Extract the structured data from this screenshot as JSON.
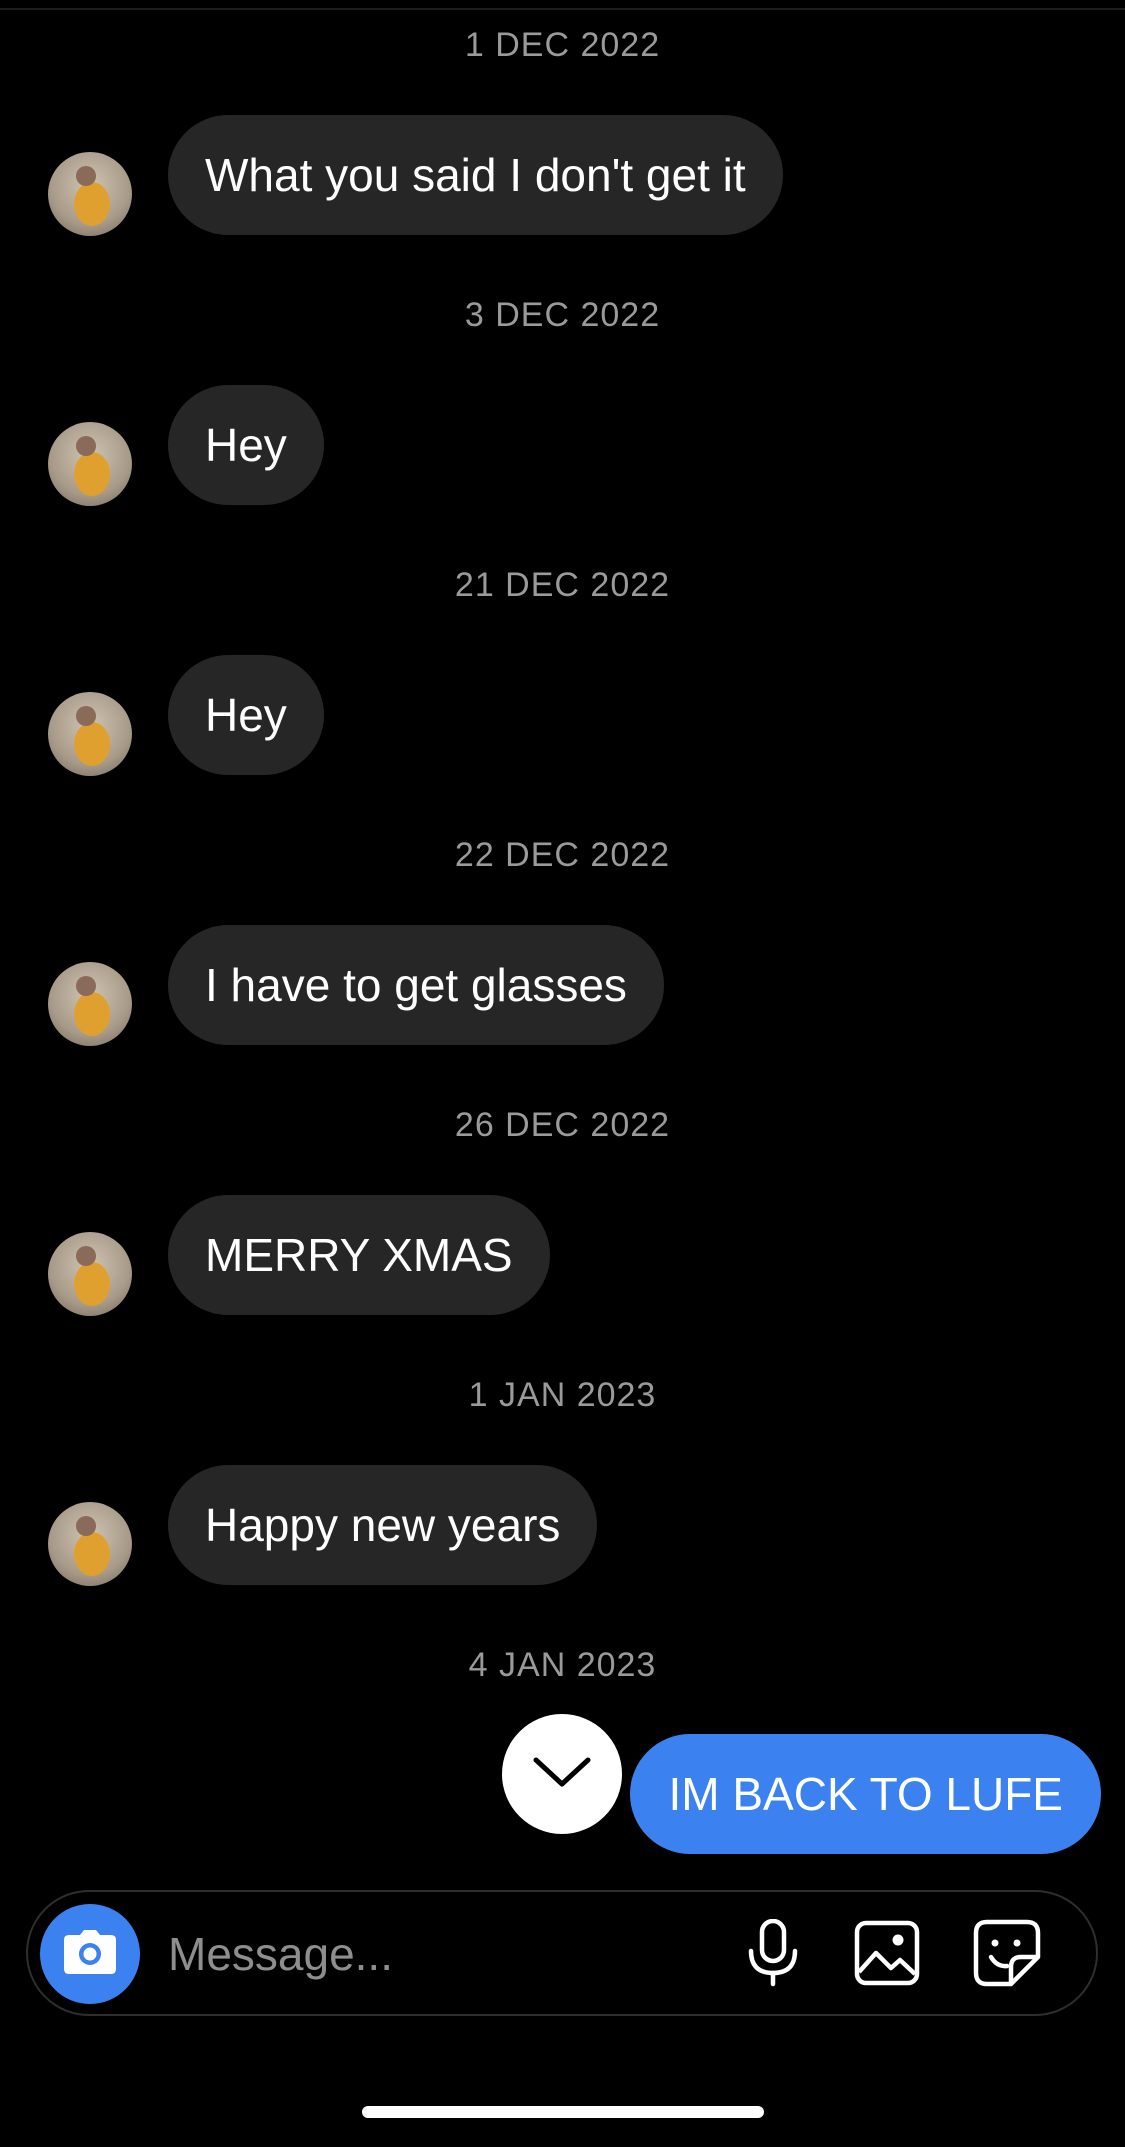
{
  "conversation": {
    "messages": [
      {
        "date": "1 DEC 2022",
        "text": "What you said I don't get it"
      },
      {
        "date": "3 DEC 2022",
        "text": "Hey"
      },
      {
        "date": "21 DEC 2022",
        "text": "Hey"
      },
      {
        "date": "22 DEC 2022",
        "text": "I have to get glasses"
      },
      {
        "date": "26 DEC 2022",
        "text": "MERRY XMAS"
      },
      {
        "date": "1 JAN 2023",
        "text": "Happy new years"
      }
    ],
    "outgoing": {
      "date": "4 JAN 2023",
      "text": "IM BACK TO LUFE"
    }
  },
  "composer": {
    "placeholder": "Message..."
  },
  "icons": {
    "camera": "camera-icon",
    "microphone": "microphone-icon",
    "gallery": "image-icon",
    "sticker": "sticker-icon",
    "scroll": "chevron-down-icon"
  },
  "colors": {
    "background": "#000000",
    "incoming_bubble": "#262626",
    "outgoing_bubble": "#3b82f0",
    "date_text": "#9a9a9a"
  }
}
